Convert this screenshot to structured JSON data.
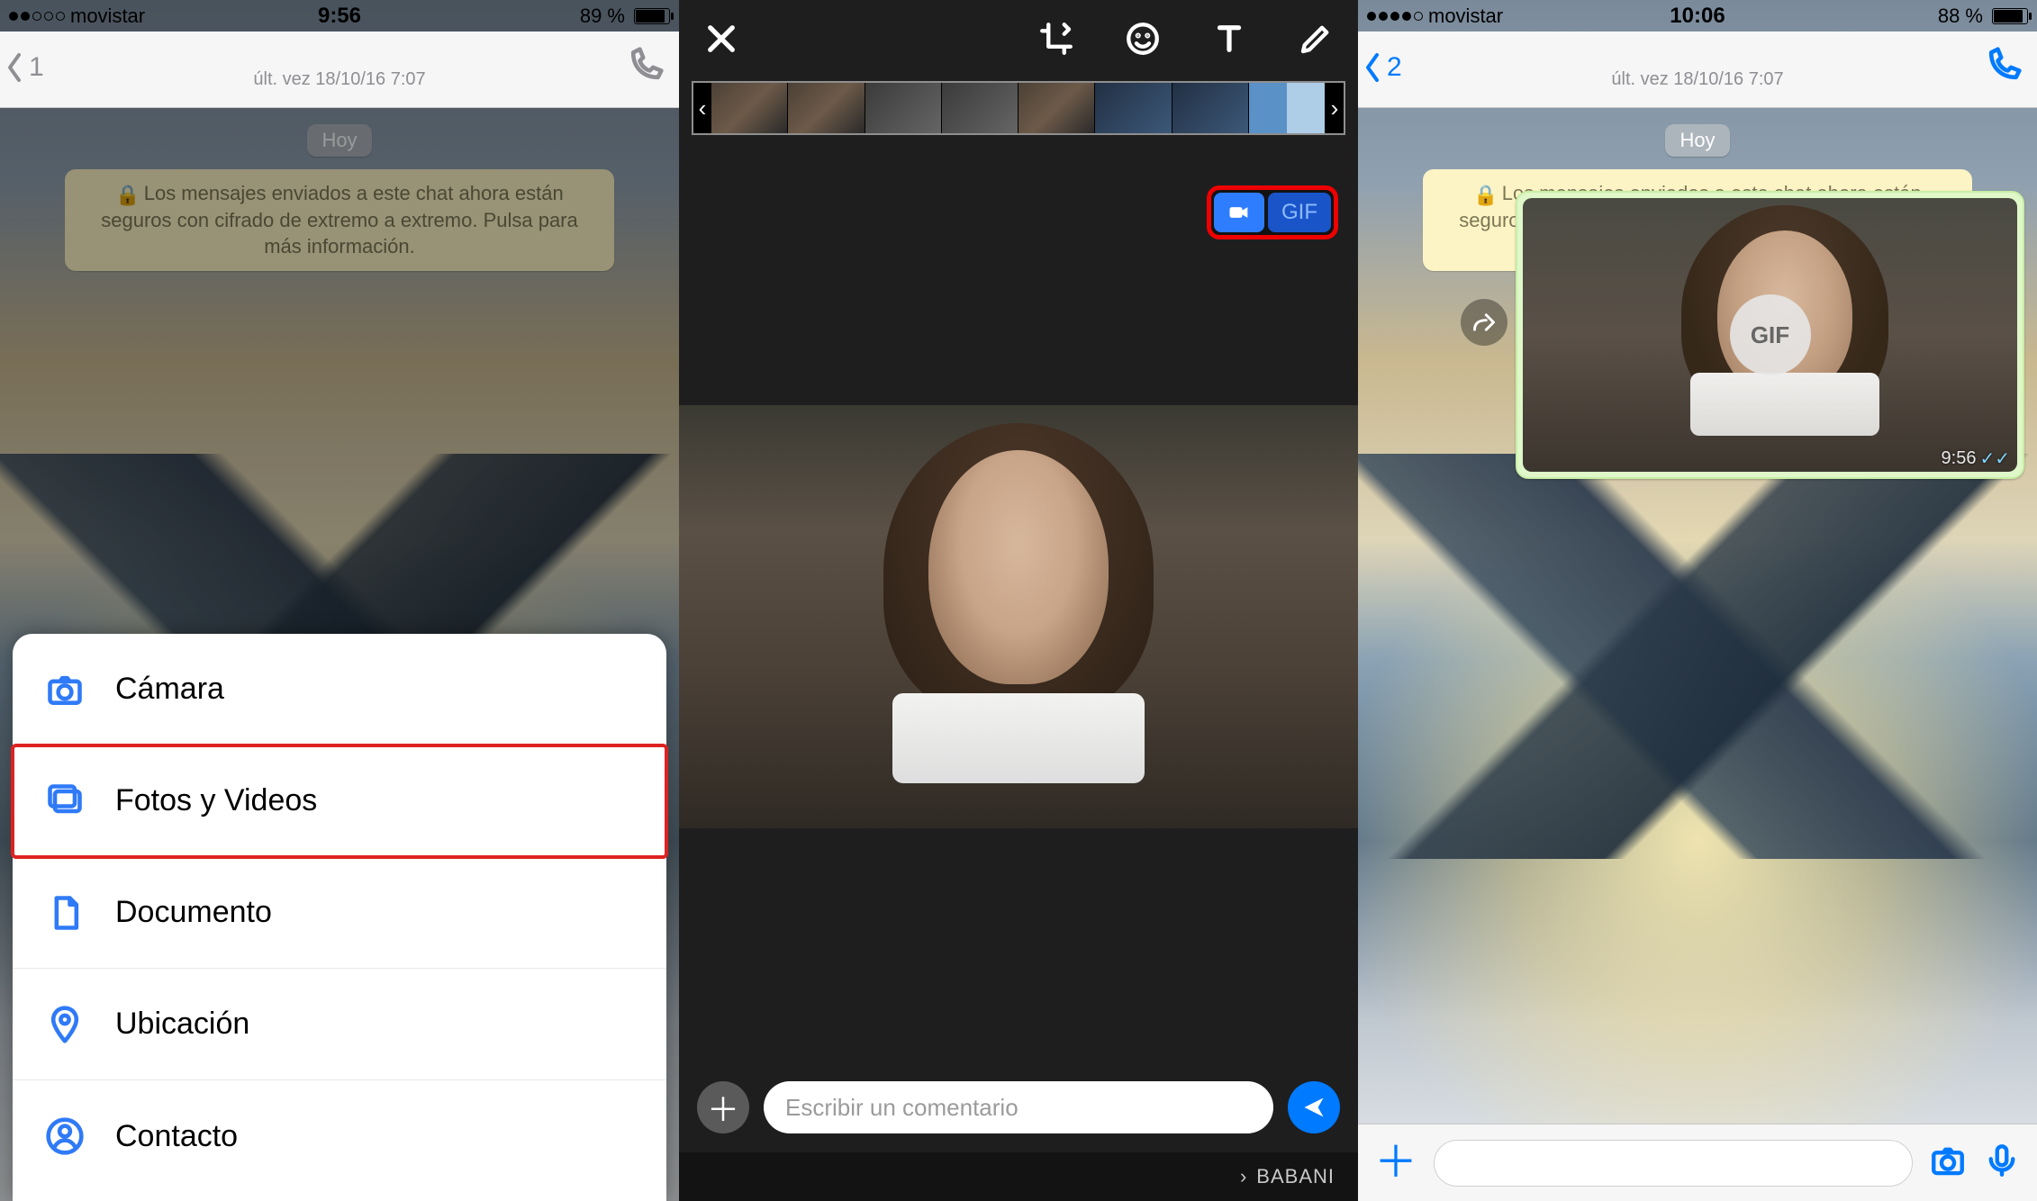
{
  "panel1": {
    "status": {
      "carrier": "movistar",
      "time": "9:56",
      "battery": "89 %"
    },
    "header": {
      "back_count": "1",
      "last_seen": "últ. vez 18/10/16 7:07"
    },
    "chat": {
      "day_chip": "Hoy",
      "encryption_notice": "Los mensajes enviados a este chat ahora están seguros con cifrado de extremo a extremo. Pulsa para más información."
    },
    "sheet": {
      "camera": "Cámara",
      "photos_videos": "Fotos y Videos",
      "document": "Documento",
      "location": "Ubicación",
      "contact": "Contacto"
    }
  },
  "panel2": {
    "toggle": {
      "gif_label": "GIF"
    },
    "comment_placeholder": "Escribir un comentario",
    "recipient": "BABANI"
  },
  "panel3": {
    "status": {
      "carrier": "movistar",
      "time": "10:06",
      "battery": "88 %"
    },
    "header": {
      "back_count": "2",
      "last_seen": "últ. vez 18/10/16 7:07"
    },
    "chat": {
      "day_chip": "Hoy",
      "encryption_notice": "Los mensajes enviados a este chat ahora están seguros con cifrado de extremo a extremo. Pulsa para más información.",
      "gif_badge": "GIF",
      "bubble_time": "9:56"
    }
  }
}
